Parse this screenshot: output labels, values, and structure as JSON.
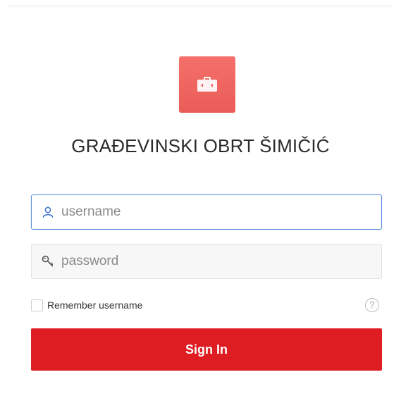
{
  "app": {
    "title": "GRAĐEVINSKI OBRT ŠIMIČIĆ",
    "logo_icon": "briefcase-icon",
    "logo_color": "#f06a65"
  },
  "form": {
    "username": {
      "icon": "user-icon",
      "placeholder": "username",
      "value": ""
    },
    "password": {
      "icon": "key-icon",
      "placeholder": "password",
      "value": ""
    },
    "remember": {
      "label": "Remember username",
      "checked": false
    },
    "help_icon": "help-icon",
    "help_glyph": "?",
    "submit_label": "Sign In"
  },
  "colors": {
    "accent": "#de1d22",
    "focus_border": "#5b8bd8"
  }
}
